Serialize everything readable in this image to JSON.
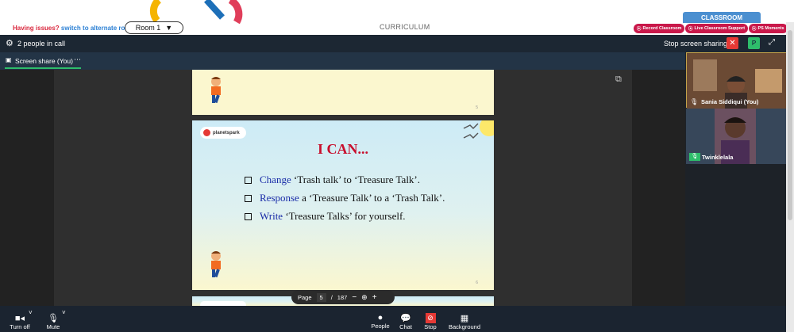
{
  "header": {
    "issues_text": "Having issues?",
    "switch_link": "switch to alternate room",
    "room_select": "Room 1",
    "curriculum_label": "CURRICULUM",
    "classroom_tab": "CLASSROOM",
    "pills": [
      "Record Classroom",
      "Live Classroom Support",
      "PS Moments"
    ]
  },
  "call": {
    "people_count": "2 people in call",
    "stop_sharing": "Stop screen sharing",
    "avatar_letter": "P",
    "tab_label": "Screen share (You)"
  },
  "slide": {
    "prev_page_number": "5",
    "brand": "planetspark",
    "title": "I CAN...",
    "bullets": [
      {
        "kw": "Change",
        "rest": " ‘Trash talk’ to ‘Treasure Talk’."
      },
      {
        "kw": "Response",
        "rest": " a ‘Treasure Talk’ to a ‘Trash Talk’."
      },
      {
        "kw": "Write",
        "rest": " ‘Treasure Talks’ for yourself."
      }
    ],
    "page_number": "6"
  },
  "pager": {
    "label": "Page",
    "current": "5",
    "separator": "/",
    "total": "187",
    "minus": "−",
    "plus": "+"
  },
  "participants": [
    {
      "name": "Sania Siddiqui (You)"
    },
    {
      "name": "Twinklelala"
    }
  ],
  "toolbar": {
    "left": [
      "Turn off",
      "Mute"
    ],
    "center": [
      "People",
      "Chat",
      "Stop",
      "Background"
    ]
  },
  "colors": {
    "accent_red": "#d9263c",
    "link_blue": "#2a7fd4",
    "pill_red": "#c9184a",
    "call_bg": "#1c2733",
    "green": "#2ebd6b"
  }
}
